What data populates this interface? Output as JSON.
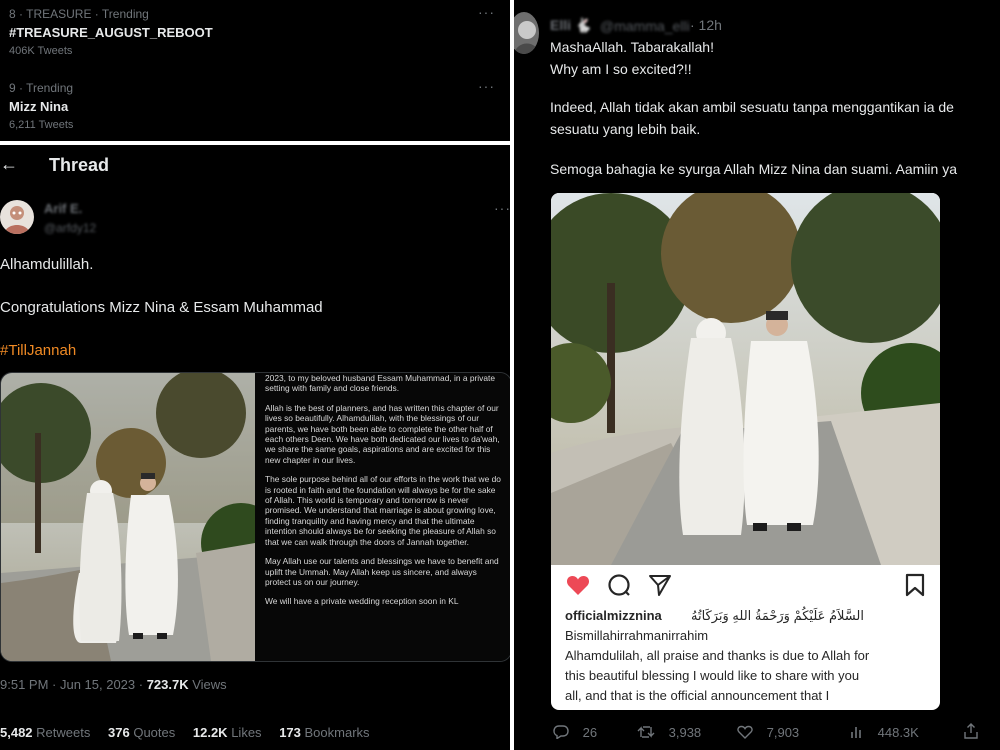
{
  "trends": [
    {
      "meta": "8 · TREASURE · Trending",
      "name": "#TREASURE_AUGUST_REBOOT",
      "count": "406K Tweets"
    },
    {
      "meta": "9 · Trending",
      "name": "Mizz Nina",
      "count": "6,211 Tweets"
    }
  ],
  "thread": {
    "title": "Thread",
    "author_name": "Arif E.",
    "author_handle": "@arfdy12",
    "lines": [
      "Alhamdulillah.",
      "Congratulations Mizz Nina & Essam Muhammad"
    ],
    "hashtag": "#TillJannah",
    "letter": [
      "2023, to my beloved husband Essam Muhammad, in a private setting with family and close friends.",
      "Allah is the best of planners, and has written this chapter of our lives so beautifully. Alhamdulilah, with the blessings of our parents, we have both been able to complete the other half of each others Deen. We have both dedicated our lives to da'wah, we share the same goals, aspirations and are excited for this new chapter in our lives.",
      "The sole purpose behind all of our efforts in the work that we do is rooted in faith and the foundation will always be for the sake of Allah. This world is temporary and tomorrow is never promised. We understand that marriage is about growing love, finding tranquility and having mercy and that the ultimate intention should always be for seeking the pleasure of Allah so that we can walk through the doors of Jannah together.",
      "May Allah use our talents and blessings we have to benefit and uplift the Ummah. May Allah keep us sincere, and always protect us on our journey.",
      "We will have a private wedding reception soon in KL"
    ],
    "time": "9:51 PM · Jun 15, 2023 · ",
    "views_num": "723.7K",
    "views_label": " Views",
    "stats": [
      {
        "num": "5,482",
        "label": "Retweets"
      },
      {
        "num": "376",
        "label": "Quotes"
      },
      {
        "num": "12.2K",
        "label": "Likes"
      },
      {
        "num": "173",
        "label": "Bookmarks"
      }
    ]
  },
  "reply": {
    "name": "Elli 🐇",
    "handle": "@mamma_elli",
    "time": "· 12h",
    "lines": [
      "MashaAllah. Tabarakallah!",
      "Why am I so excited?!!",
      "Indeed, Allah tidak akan ambil sesuatu tanpa menggantikan ia de",
      "sesuatu yang lebih baik.",
      "Semoga bahagia ke syurga Allah Mizz Nina dan suami.  Aamiin ya"
    ],
    "ig": {
      "username": "officialmizznina",
      "arabic": "السَّلاَمُ عَلَيْكُمْ وَرَحْمَةُ اللهِ وَبَرَكَاتُهُ",
      "lines": [
        "Bismillahirrahmanirrahim",
        "Alhamdulilah, all praise and thanks is due to Allah for",
        "this beautiful blessing I would like to share with you",
        "all, and that is the official announcement that I"
      ]
    },
    "actions": {
      "replies": "26",
      "retweets": "3,938",
      "likes": "7,903",
      "views": "448.3K"
    }
  },
  "colors": {
    "accent": "#f08a24",
    "like": "#e0245e",
    "muted": "#71767b"
  }
}
